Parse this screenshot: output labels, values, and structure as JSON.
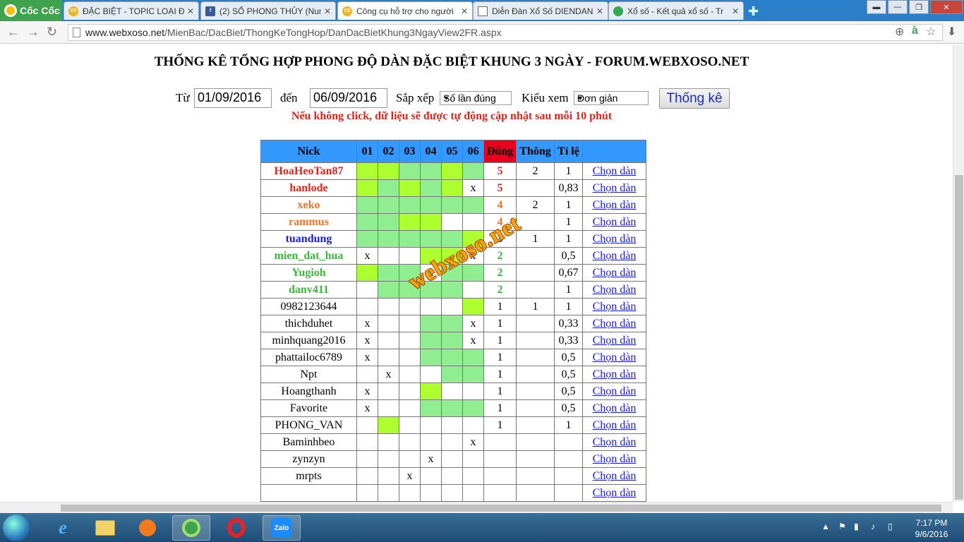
{
  "browser": {
    "brand": "Cốc Cốc",
    "tabs": [
      {
        "label": "ĐẶC BIỆT - TOPIC LOẠI Đ",
        "icon": "xoso-icon",
        "active": false
      },
      {
        "label": "(2) SỐ PHONG THỦY (Num",
        "icon": "facebook-icon",
        "active": false
      },
      {
        "label": "Công cụ hỗ trợ cho người",
        "icon": "xoso-icon",
        "active": true
      },
      {
        "label": "Diễn Đàn Xổ Số DIENDAN",
        "icon": "document-icon",
        "active": false
      },
      {
        "label": "Xổ số - Kết quả xổ số - Tr",
        "icon": "chrome-icon",
        "active": false
      }
    ],
    "url_domain": "www.webxoso.net",
    "url_path": "/MienBac/DacBiet/ThongKeTongHop/DanDacBietKhung3NgayView2FR.aspx"
  },
  "page": {
    "title": "THỐNG KÊ TỔNG HỢP PHONG ĐỘ DÀN ĐẶC BIỆT KHUNG 3 NGÀY - FORUM.WEBXOSO.NET",
    "from_label": "Từ",
    "from_value": "01/09/2016",
    "to_label": "đến",
    "to_value": "06/09/2016",
    "sort_label": "Sắp xếp",
    "sort_value": "Số lần đúng",
    "view_label": "Kiểu xem",
    "view_value": "Đơn giản",
    "submit_label": "Thống kê",
    "note": "Nếu không click, dữ liệu sẽ được tự động cập nhật sau mỗi 10 phút",
    "watermark": "webxoso.net"
  },
  "table": {
    "headers": [
      "Nick",
      "01",
      "02",
      "03",
      "04",
      "05",
      "06",
      "Đúng",
      "Thông",
      "Tỉ lệ",
      ""
    ],
    "rows": [
      {
        "nick": "HoaHeoTan87",
        "color": "#e1241b",
        "cells": [
          "g1",
          "g1",
          "g2",
          "g2",
          "g1",
          "g2"
        ],
        "marks": [
          "",
          "",
          "",
          "",
          "",
          ""
        ],
        "dung": "5",
        "thong": "2",
        "tile": "1",
        "action": "Chọn dàn"
      },
      {
        "nick": "hanlode",
        "color": "#e1241b",
        "cells": [
          "g1",
          "g2",
          "g1",
          "g2",
          "g1",
          ""
        ],
        "marks": [
          "",
          "",
          "",
          "",
          "",
          "x"
        ],
        "dung": "5",
        "thong": "",
        "tile": "0,83",
        "action": "Chọn dàn"
      },
      {
        "nick": "xeko",
        "color": "#f0742a",
        "cells": [
          "g2",
          "g2",
          "g2",
          "g2",
          "g2",
          "g2"
        ],
        "marks": [
          "",
          "",
          "",
          "",
          "",
          ""
        ],
        "dung": "4",
        "thong": "2",
        "tile": "1",
        "action": "Chọn dàn"
      },
      {
        "nick": "rammus",
        "color": "#f0742a",
        "cells": [
          "g2",
          "g2",
          "g1",
          "g1",
          "",
          ""
        ],
        "marks": [
          "",
          "",
          "",
          "",
          "",
          ""
        ],
        "dung": "4",
        "thong": "",
        "tile": "1",
        "action": "Chọn dàn"
      },
      {
        "nick": "tuandung",
        "color": "#1a1ae6",
        "cells": [
          "g2",
          "g2",
          "g2",
          "g2",
          "g2",
          "g1"
        ],
        "marks": [
          "",
          "",
          "",
          "",
          "",
          ""
        ],
        "dung": "3",
        "thong": "1",
        "tile": "1",
        "action": "Chọn dàn"
      },
      {
        "nick": "mien_dat_hua",
        "color": "#3cb93c",
        "cells": [
          "",
          "",
          "",
          "g1",
          "g1",
          ""
        ],
        "marks": [
          "x",
          "",
          "",
          "",
          "",
          "x"
        ],
        "dung": "2",
        "thong": "",
        "tile": "0,5",
        "action": "Chọn dàn"
      },
      {
        "nick": "Yugioh",
        "color": "#3cb93c",
        "cells": [
          "g1",
          "g2",
          "g2",
          "",
          "g2",
          "g2"
        ],
        "marks": [
          "",
          "",
          "",
          "x",
          "",
          ""
        ],
        "dung": "2",
        "thong": "",
        "tile": "0,67",
        "action": "Chọn dàn"
      },
      {
        "nick": "danv411",
        "color": "#3cb93c",
        "cells": [
          "",
          "g2",
          "g2",
          "g2",
          "g2",
          ""
        ],
        "marks": [
          "",
          "",
          "",
          "",
          "",
          ""
        ],
        "dung": "2",
        "thong": "",
        "tile": "1",
        "action": "Chọn dàn"
      },
      {
        "nick": "0982123644",
        "color": "#000",
        "cells": [
          "",
          "",
          "",
          "",
          "",
          "g1"
        ],
        "marks": [
          "",
          "",
          "",
          "",
          "",
          ""
        ],
        "dung": "1",
        "thong": "1",
        "tile": "1",
        "action": "Chọn dàn"
      },
      {
        "nick": "thichduhet",
        "color": "#000",
        "cells": [
          "",
          "",
          "",
          "g2",
          "g2",
          ""
        ],
        "marks": [
          "x",
          "",
          "",
          "",
          "",
          "x"
        ],
        "dung": "1",
        "thong": "",
        "tile": "0,33",
        "action": "Chọn dàn"
      },
      {
        "nick": "minhquang2016",
        "color": "#000",
        "cells": [
          "",
          "",
          "",
          "g2",
          "g2",
          ""
        ],
        "marks": [
          "x",
          "",
          "",
          "",
          "",
          "x"
        ],
        "dung": "1",
        "thong": "",
        "tile": "0,33",
        "action": "Chọn dàn"
      },
      {
        "nick": "phattailoc6789",
        "color": "#000",
        "cells": [
          "",
          "",
          "",
          "g2",
          "g2",
          "g2"
        ],
        "marks": [
          "x",
          "",
          "",
          "",
          "",
          ""
        ],
        "dung": "1",
        "thong": "",
        "tile": "0,5",
        "action": "Chọn dàn"
      },
      {
        "nick": "Npt",
        "color": "#000",
        "cells": [
          "",
          "",
          "",
          "",
          "g2",
          "g2"
        ],
        "marks": [
          "",
          "x",
          "",
          "",
          "",
          ""
        ],
        "dung": "1",
        "thong": "",
        "tile": "0,5",
        "action": "Chọn dàn"
      },
      {
        "nick": "Hoangthanh",
        "color": "#000",
        "cells": [
          "",
          "",
          "",
          "g1",
          "",
          ""
        ],
        "marks": [
          "x",
          "",
          "",
          "",
          "",
          ""
        ],
        "dung": "1",
        "thong": "",
        "tile": "0,5",
        "action": "Chọn dàn"
      },
      {
        "nick": "Favorite",
        "color": "#000",
        "cells": [
          "",
          "",
          "",
          "g2",
          "g2",
          "g2"
        ],
        "marks": [
          "x",
          "",
          "",
          "",
          "",
          ""
        ],
        "dung": "1",
        "thong": "",
        "tile": "0,5",
        "action": "Chọn dàn"
      },
      {
        "nick": "PHONG_VAN",
        "color": "#000",
        "cells": [
          "",
          "g1",
          "",
          "",
          "",
          ""
        ],
        "marks": [
          "",
          "",
          "",
          "",
          "",
          ""
        ],
        "dung": "1",
        "thong": "",
        "tile": "1",
        "action": "Chọn dàn"
      },
      {
        "nick": "Baminhbeo",
        "color": "#000",
        "cells": [
          "",
          "",
          "",
          "",
          "",
          ""
        ],
        "marks": [
          "",
          "",
          "",
          "",
          "",
          "x"
        ],
        "dung": "",
        "thong": "",
        "tile": "",
        "action": "Chọn dàn"
      },
      {
        "nick": "zynzyn",
        "color": "#000",
        "cells": [
          "",
          "",
          "",
          "",
          "",
          ""
        ],
        "marks": [
          "",
          "",
          "",
          "x",
          "",
          ""
        ],
        "dung": "",
        "thong": "",
        "tile": "",
        "action": "Chọn dàn"
      },
      {
        "nick": "mrpts",
        "color": "#000",
        "cells": [
          "",
          "",
          "",
          "",
          "",
          ""
        ],
        "marks": [
          "",
          "",
          "x",
          "",
          "",
          ""
        ],
        "dung": "",
        "thong": "",
        "tile": "",
        "action": "Chọn dàn"
      },
      {
        "nick": "",
        "color": "#000",
        "cells": [
          "",
          "",
          "",
          "",
          "",
          ""
        ],
        "marks": [
          "",
          "",
          "",
          "",
          "",
          ""
        ],
        "dung": "",
        "thong": "",
        "tile": "",
        "action": "Chọn dàn"
      }
    ]
  },
  "taskbar": {
    "time": "7:17 PM",
    "date": "9/6/2016",
    "apps": [
      "ie-icon",
      "explorer-icon",
      "media-player-icon",
      "coccoc-icon",
      "opera-icon",
      "zalo-icon"
    ],
    "zalo_label": "Zalo"
  }
}
